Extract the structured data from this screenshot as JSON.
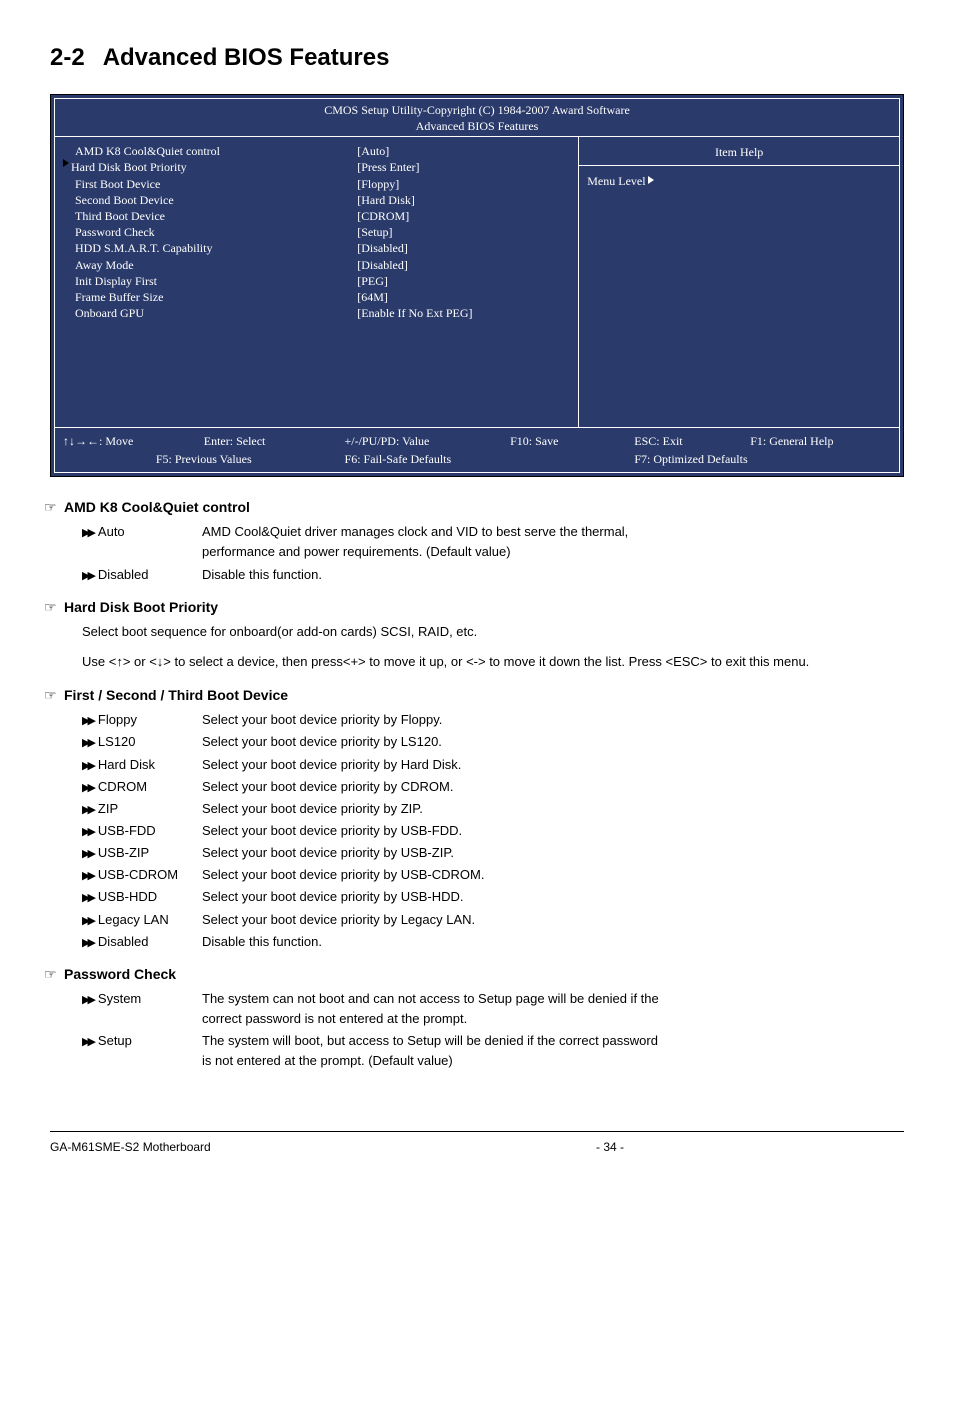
{
  "section": {
    "num": "2-2",
    "title": "Advanced BIOS Features"
  },
  "bios": {
    "header1": "CMOS Setup Utility-Copyright (C) 1984-2007 Award Software",
    "header2": "Advanced BIOS Features",
    "rows": [
      {
        "label": "AMD K8 Cool&Quiet control",
        "value": "[Auto]",
        "indent": true
      },
      {
        "label": "Hard Disk Boot Priority",
        "value": "[Press Enter]",
        "marker": true
      },
      {
        "label": "First Boot Device",
        "value": "[Floppy]",
        "indent": true
      },
      {
        "label": "Second Boot Device",
        "value": "[Hard Disk]",
        "indent": true
      },
      {
        "label": "Third Boot Device",
        "value": "[CDROM]",
        "indent": true
      },
      {
        "label": "Password Check",
        "value": "[Setup]",
        "indent": true
      },
      {
        "label": "HDD S.M.A.R.T. Capability",
        "value": "[Disabled]",
        "indent": true
      },
      {
        "label": "Away Mode",
        "value": "[Disabled]",
        "indent": true
      },
      {
        "label": "Init Display First",
        "value": "[PEG]",
        "indent": true
      },
      {
        "label": "Frame Buffer Size",
        "value": "[64M]",
        "indent": true
      },
      {
        "label": "Onboard GPU",
        "value": "[Enable If No Ext PEG]",
        "indent": true
      }
    ],
    "help_title": "Item Help",
    "help_sub": "Menu Level",
    "footer": {
      "r1c1": "↑↓→←: Move",
      "r1c2": "Enter: Select",
      "r1c3": "+/-/PU/PD: Value",
      "r1c4": "F10: Save",
      "r1c5": "ESC: Exit",
      "r1c6": "F1: General Help",
      "r2c1": "F5: Previous Values",
      "r2c2": "F6: Fail-Safe Defaults",
      "r2c3": "F7: Optimized Defaults"
    }
  },
  "items": {
    "amd": {
      "title": "AMD K8 Cool&Quiet control",
      "auto": {
        "label": "Auto",
        "desc1": "AMD Cool&Quiet driver manages clock and VID to best serve the thermal,",
        "desc2": "performance and power requirements. (Default value)"
      },
      "disabled": {
        "label": "Disabled",
        "desc": "Disable this function."
      }
    },
    "hdbp": {
      "title": "Hard Disk Boot Priority",
      "p1": "Select boot sequence for onboard(or add-on cards) SCSI, RAID, etc.",
      "p2": "Use <↑> or <↓> to select a device, then press<+> to move it up, or <-> to move it down the list. Press <ESC> to exit this menu."
    },
    "boot": {
      "title": "First / Second / Third Boot Device",
      "opts": [
        {
          "label": "Floppy",
          "desc": "Select your boot device priority by Floppy."
        },
        {
          "label": "LS120",
          "desc": "Select your boot device priority by LS120."
        },
        {
          "label": "Hard Disk",
          "desc": "Select your boot device priority by Hard Disk."
        },
        {
          "label": "CDROM",
          "desc": "Select your boot device priority by CDROM."
        },
        {
          "label": "ZIP",
          "desc": "Select your boot device priority by ZIP."
        },
        {
          "label": "USB-FDD",
          "desc": "Select your boot device priority by USB-FDD."
        },
        {
          "label": "USB-ZIP",
          "desc": "Select your boot device priority by USB-ZIP."
        },
        {
          "label": "USB-CDROM",
          "desc": "Select your boot device priority by USB-CDROM."
        },
        {
          "label": "USB-HDD",
          "desc": "Select your boot device priority by USB-HDD."
        },
        {
          "label": "Legacy LAN",
          "desc": "Select your boot device priority by Legacy LAN."
        },
        {
          "label": "Disabled",
          "desc": "Disable this function."
        }
      ]
    },
    "pwd": {
      "title": "Password Check",
      "system": {
        "label": "System",
        "desc1": "The system can not boot and can not access to Setup page will be denied if the",
        "desc2": "correct password is not entered at the prompt."
      },
      "setup": {
        "label": "Setup",
        "desc1": "The system will boot, but access to Setup will be denied if the correct password",
        "desc2": "is not entered at the prompt. (Default value)"
      }
    }
  },
  "footer": {
    "left": "GA-M61SME-S2 Motherboard",
    "center": "- 34 -"
  }
}
